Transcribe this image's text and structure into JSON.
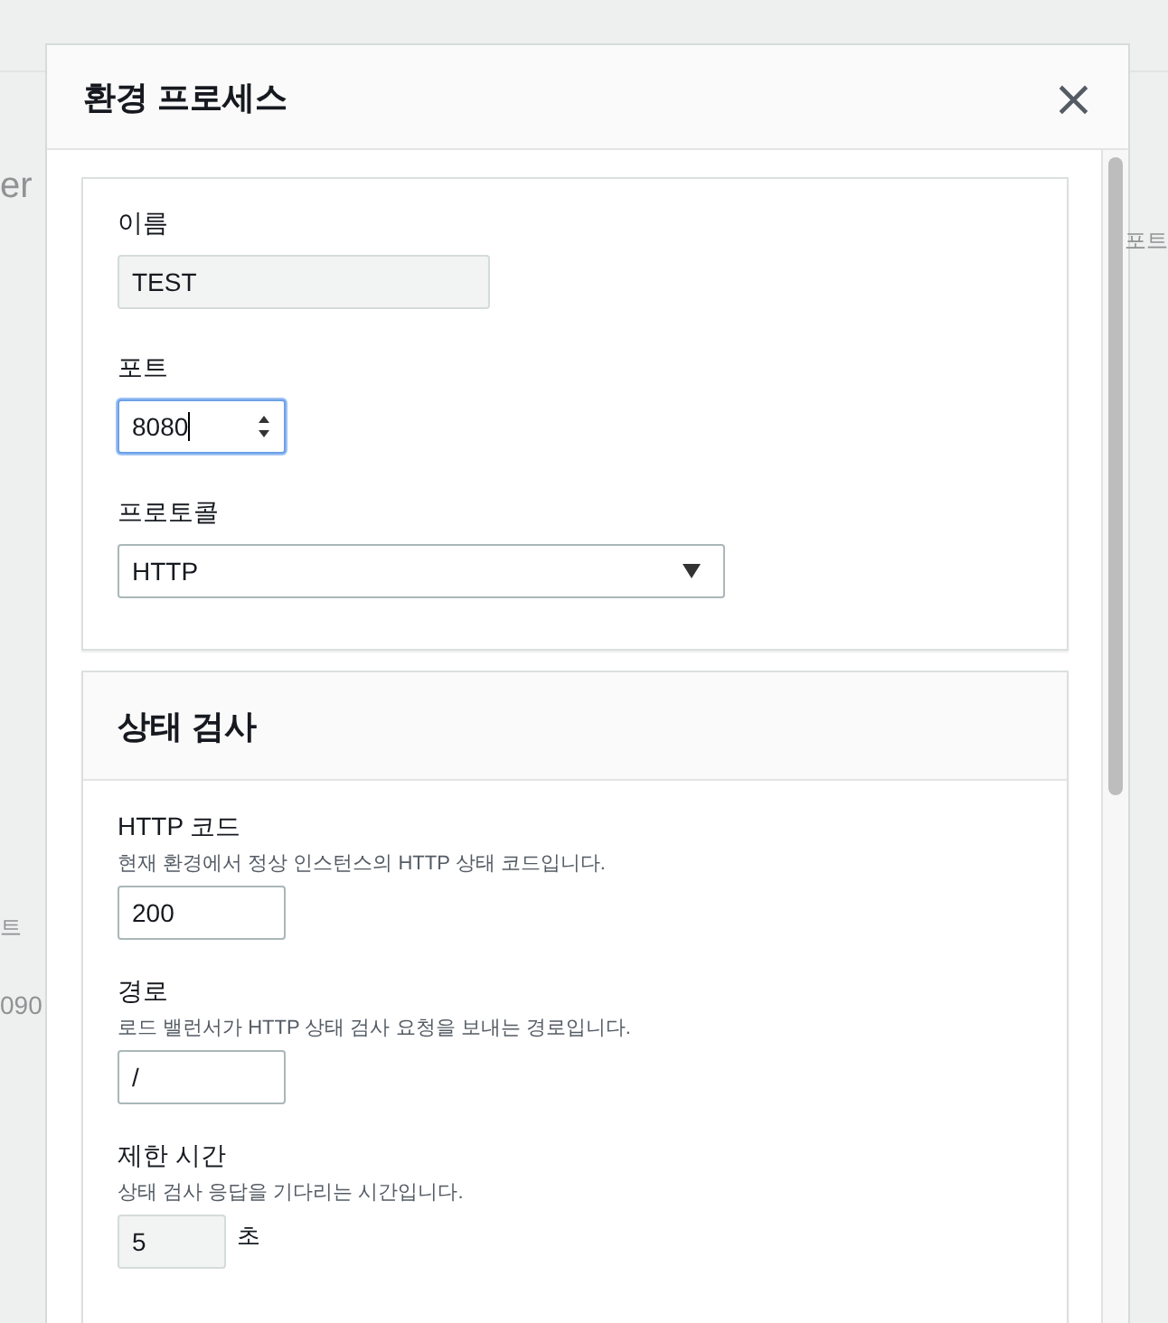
{
  "background": {
    "left_fragments": [
      {
        "text": "er"
      },
      {
        "text": "트"
      },
      {
        "text": "090"
      }
    ],
    "right_fragments": [
      {
        "text": "포트"
      }
    ]
  },
  "dialog": {
    "title": "환경 프로세스",
    "close_label": "×"
  },
  "general_fields": [
    {
      "label": "이름",
      "kind": "text",
      "value": "TEST",
      "disabled": true,
      "focused": false
    },
    {
      "label": "포트",
      "kind": "number",
      "value": "8080",
      "disabled": false,
      "focused": true
    },
    {
      "label": "프로토콜",
      "kind": "select",
      "value": "HTTP",
      "disabled": false,
      "focused": false
    }
  ],
  "health_check": {
    "title": "상태 검사",
    "fields": [
      {
        "label": "HTTP 코드",
        "description": "현재 환경에서 정상 인스턴스의 HTTP 상태 코드입니다.",
        "kind": "text",
        "value": "200",
        "disabled": false,
        "focused": false
      },
      {
        "label": "경로",
        "description": "로드 밸런서가 HTTP 상태 검사 요청을 보내는 경로입니다.",
        "kind": "text",
        "value": "/",
        "disabled": false,
        "focused": false
      },
      {
        "label": "제한 시간",
        "description": "상태 검사 응답을 기다리는 시간입니다.",
        "kind": "text",
        "value": "5",
        "disabled": true,
        "focused": false,
        "unit": "초"
      }
    ]
  }
}
